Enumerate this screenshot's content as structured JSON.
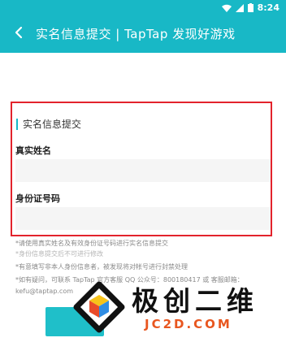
{
  "status_bar": {
    "time": "8:24",
    "icons": [
      "wifi-icon",
      "signal-icon",
      "battery-icon"
    ]
  },
  "toolbar": {
    "title": "实名信息提交 | TapTap 发现好游戏",
    "back_icon": "back-arrow-icon"
  },
  "form": {
    "section_title": "实名信息提交",
    "name_label": "真实姓名",
    "name_value": "",
    "id_label": "身份证号码",
    "id_value": ""
  },
  "notes": [
    "*请使用真实姓名及有效身份证号码进行实名信息提交",
    "*身份信息提交后不可进行修改",
    "*有意填写非本人身份信息者，被发现将对帐号进行封禁处理",
    "*如有疑问，可联系 TapTap 官方客服 QQ 公众号：800180417 或 客服邮箱：",
    "kefu@taptap.com"
  ],
  "watermark": {
    "brand": "极创二维",
    "domain": "JC2D.COM"
  },
  "colors": {
    "accent": "#18b8c6",
    "highlight_border": "#e3232c",
    "watermark_orange": "#e8561f"
  }
}
